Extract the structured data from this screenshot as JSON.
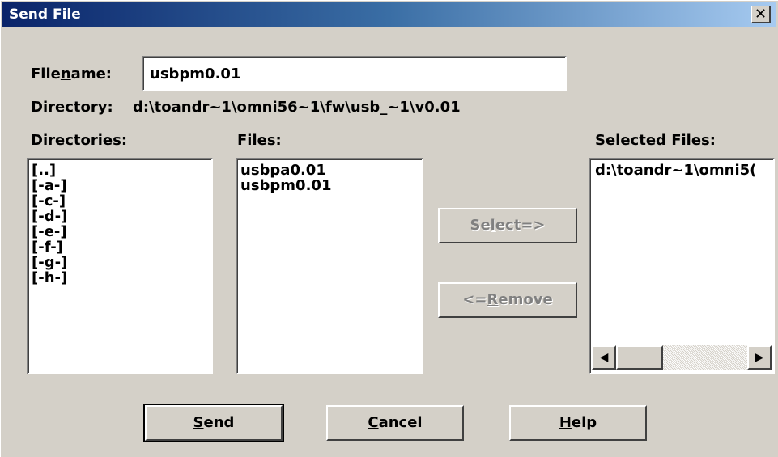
{
  "window": {
    "title": "Send File",
    "close_glyph": "✕"
  },
  "filename": {
    "label_pre": "File",
    "label_u": "n",
    "label_post": "ame:",
    "value": "usbpm0.01"
  },
  "directory": {
    "label": "Directory:",
    "value": "d:\\toandr~1\\omni56~1\\fw\\usb_~1\\v0.01"
  },
  "directories": {
    "label_u": "D",
    "label_post": "irectories:",
    "items": [
      "[..]",
      "[-a-]",
      "[-c-]",
      "[-d-]",
      "[-e-]",
      "[-f-]",
      "[-g-]",
      "[-h-]"
    ]
  },
  "files": {
    "label_u": "F",
    "label_post": "iles:",
    "items": [
      "usbpa0.01",
      "usbpm0.01"
    ]
  },
  "selected_files": {
    "label_pre": "Selec",
    "label_u": "t",
    "label_post": "ed Files:",
    "items": [
      "d:\\toandr~1\\omni5("
    ]
  },
  "buttons": {
    "select": {
      "pre": "Se",
      "u": "l",
      "post": "ect=>"
    },
    "remove": {
      "pre": "<=",
      "u": "R",
      "post": "emove"
    },
    "send": {
      "u": "S",
      "post": "end"
    },
    "cancel": {
      "u": "C",
      "post": "ancel"
    },
    "help": {
      "u": "H",
      "post": "elp"
    }
  },
  "scrollbar": {
    "left_icon": "arrow-left-icon",
    "right_icon": "arrow-right-icon",
    "left_glyph": "◀",
    "right_glyph": "▶"
  }
}
